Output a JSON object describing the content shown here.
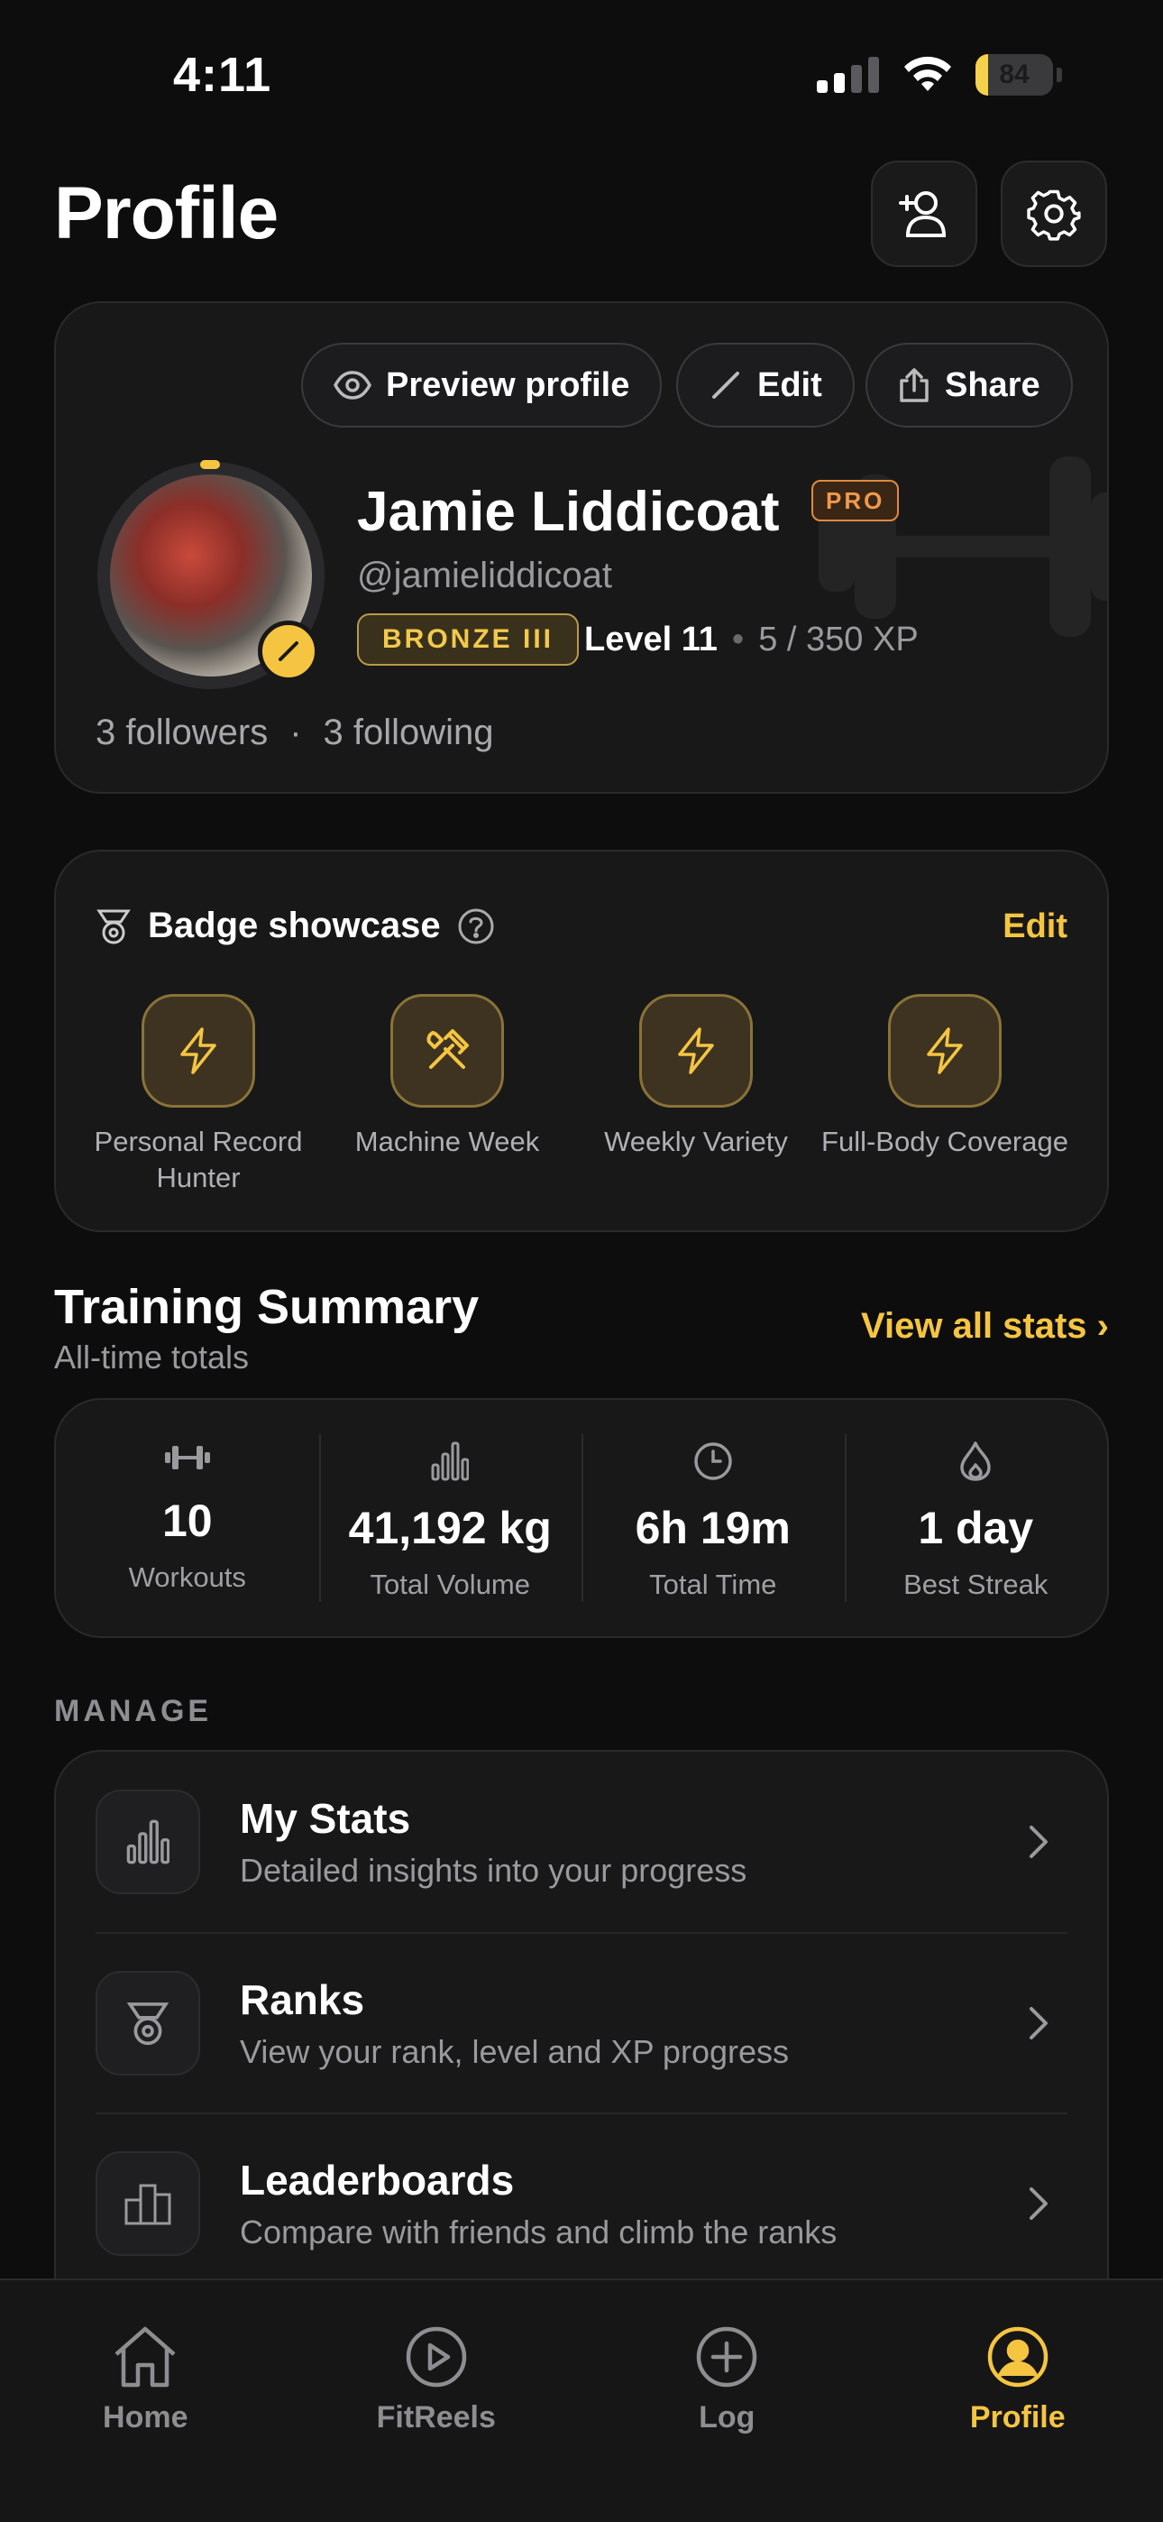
{
  "status_bar": {
    "time": "4:11",
    "battery": "84"
  },
  "header": {
    "title": "Profile"
  },
  "profile": {
    "actions": {
      "preview": "Preview profile",
      "edit": "Edit",
      "share": "Share"
    },
    "name": "Jamie Liddicoat",
    "pro_label": "PRO",
    "handle": "@jamieliddicoat",
    "rank": "BRONZE III",
    "level": "Level 11",
    "xp": "5 / 350 XP",
    "followers": "3 followers",
    "separator": "·",
    "following": "3 following"
  },
  "badges": {
    "title": "Badge showcase",
    "edit_label": "Edit",
    "items": [
      {
        "label": "Personal Record Hunter",
        "icon": "bolt-icon"
      },
      {
        "label": "Machine Week",
        "icon": "tools-icon"
      },
      {
        "label": "Weekly Variety",
        "icon": "bolt-icon"
      },
      {
        "label": "Full-Body Coverage",
        "icon": "bolt-icon"
      }
    ]
  },
  "training_summary": {
    "title": "Training Summary",
    "subtitle": "All-time totals",
    "view_all": "View all stats ›",
    "stats": [
      {
        "value": "10",
        "label": "Workouts",
        "icon": "dumbbell-icon"
      },
      {
        "value": "41,192 kg",
        "label": "Total Volume",
        "icon": "bar-chart-icon"
      },
      {
        "value": "6h 19m",
        "label": "Total Time",
        "icon": "clock-icon"
      },
      {
        "value": "1 day",
        "label": "Best Streak",
        "icon": "flame-icon"
      }
    ]
  },
  "manage": {
    "label": "MANAGE",
    "items": [
      {
        "title": "My Stats",
        "subtitle": "Detailed insights into your progress",
        "icon": "bar-chart-icon"
      },
      {
        "title": "Ranks",
        "subtitle": "View your rank, level and XP progress",
        "icon": "medal-icon"
      },
      {
        "title": "Leaderboards",
        "subtitle": "Compare with friends and climb the ranks",
        "icon": "podium-icon"
      }
    ]
  },
  "tabs": [
    {
      "label": "Home",
      "icon": "home-icon"
    },
    {
      "label": "FitReels",
      "icon": "play-icon"
    },
    {
      "label": "Log",
      "icon": "plus-circle-icon"
    },
    {
      "label": "Profile",
      "icon": "profile-icon",
      "active": true
    }
  ],
  "colors": {
    "accent": "#f5c542",
    "pro": "#f09a4a",
    "background": "#0d0d0e",
    "card": "#181819"
  }
}
